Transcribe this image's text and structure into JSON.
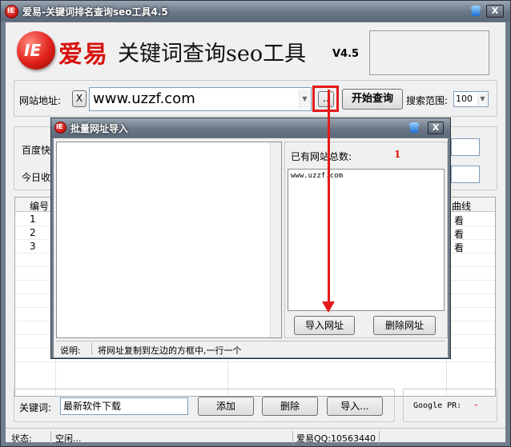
{
  "window": {
    "title": "爱易-关键词排名查询seo工具4.5",
    "close_label": "X"
  },
  "header": {
    "logo_text": "IE",
    "brand": "爱易",
    "product": "关键词查询seo工具",
    "version": "V4.5"
  },
  "url_row": {
    "label": "网站地址:",
    "clear_label": "X",
    "url_value": "www.uzzf.com",
    "browse_label": "..",
    "search_button": "开始查询",
    "range_label": "搜索范围:",
    "range_value": "100"
  },
  "stats": {
    "baidu_label": "百度快",
    "today_label": "今日收"
  },
  "table": {
    "headers": [
      "编号",
      "曲线"
    ],
    "rows": [
      {
        "id": "1",
        "curve": "看"
      },
      {
        "id": "2",
        "curve": "看"
      },
      {
        "id": "3",
        "curve": "看"
      }
    ]
  },
  "keyword_row": {
    "label": "关键词:",
    "value": "最新软件下载",
    "add_button": "添加",
    "delete_button": "删除",
    "import_button": "导入...",
    "pr_label": "Google PR:",
    "pr_value": "-"
  },
  "statusbar": {
    "state_label": "状态:",
    "state_value": "空闲...",
    "qq": "爱易QQ:10563440"
  },
  "dialog": {
    "title": "批量网址导入",
    "close_label": "X",
    "count_label": "已有网站总数:",
    "count_value": "1",
    "urls": [
      "www.uzzf.com"
    ],
    "import_button": "导入网址",
    "delete_button": "删除网址",
    "hint_label": "说明:",
    "hint_text": "将网址复制到左边的方框中,一行一个"
  },
  "colors": {
    "accent_red": "#e31a1a",
    "brand_red": "#d8130f",
    "titlebar": "#6a7787"
  }
}
